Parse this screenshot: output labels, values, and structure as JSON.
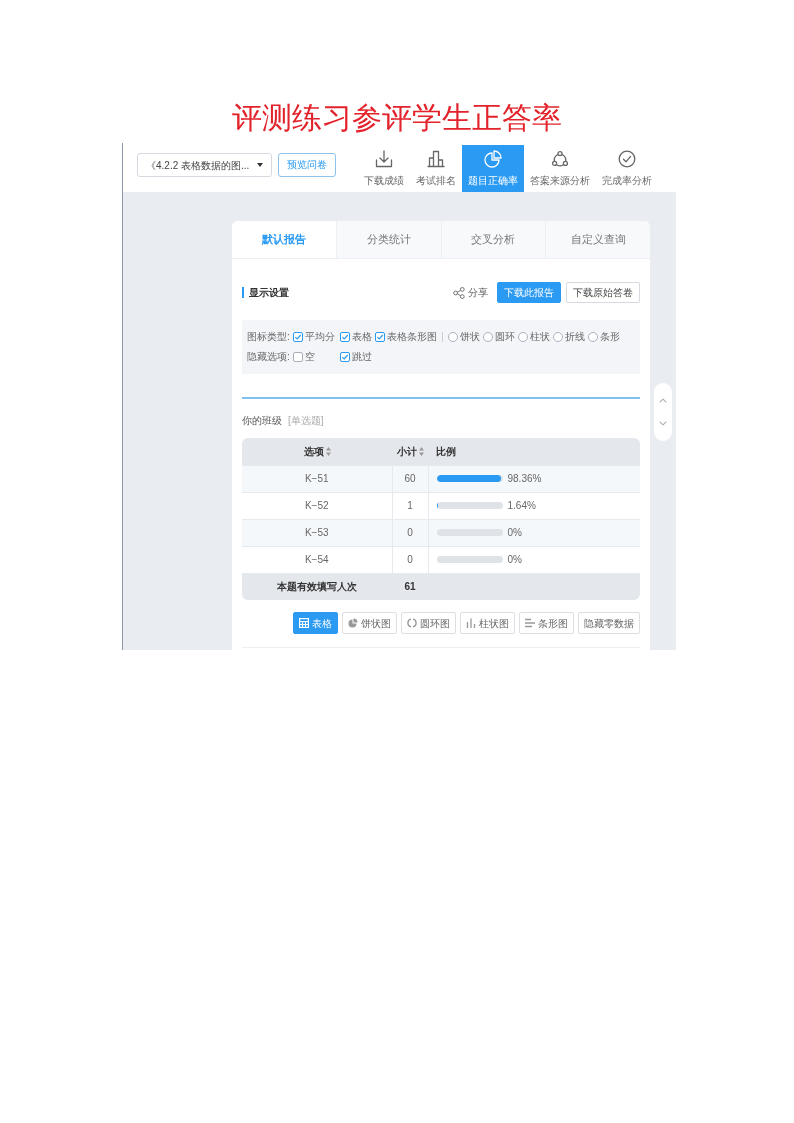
{
  "title": "评测练习参评学生正答率",
  "top_bar": {
    "survey_select": {
      "value": "《4.2.2 表格数据的图..."
    },
    "preview_button": "预览问卷",
    "tools": [
      {
        "label": "下载成绩",
        "kind": "download",
        "selected": false
      },
      {
        "label": "考试排名",
        "kind": "ranking",
        "selected": false
      },
      {
        "label": "题目正确率",
        "kind": "accuracy",
        "selected": true
      },
      {
        "label": "答案来源分析",
        "kind": "source",
        "selected": false
      },
      {
        "label": "完成率分析",
        "kind": "completion",
        "selected": false
      }
    ]
  },
  "report_tabs": [
    {
      "label": "默认报告",
      "selected": true
    },
    {
      "label": "分类统计",
      "selected": false
    },
    {
      "label": "交叉分析",
      "selected": false
    },
    {
      "label": "自定义查询",
      "selected": false
    }
  ],
  "display_settings": {
    "heading": "显示设置",
    "share_link": "分享",
    "download_report_button": "下载此报告",
    "download_answers_button": "下载原始答卷",
    "chart_type": {
      "label": "图标类型:",
      "checkboxes": [
        {
          "label": "平均分",
          "checked": true
        },
        {
          "label": "表格",
          "checked": true
        },
        {
          "label": "表格条形图",
          "checked": true
        }
      ],
      "radios": [
        {
          "label": "饼状",
          "selected": false
        },
        {
          "label": "圆环",
          "selected": false
        },
        {
          "label": "柱状",
          "selected": false
        },
        {
          "label": "折线",
          "selected": false
        },
        {
          "label": "条形",
          "selected": false
        }
      ]
    },
    "hidden_options": {
      "label": "隐藏选项:",
      "checkboxes": [
        {
          "label": "空",
          "checked": false
        },
        {
          "label": "跳过",
          "checked": true
        }
      ]
    }
  },
  "question": {
    "title": "你的班级",
    "type": "[单选题]",
    "table": {
      "columns": [
        {
          "label": "选项",
          "sortable": true
        },
        {
          "label": "小计",
          "sortable": true
        },
        {
          "label": "比例",
          "sortable": false
        }
      ],
      "rows": [
        {
          "option": "K−51",
          "count": "60",
          "level": 0.9836,
          "percent": "98.36%"
        },
        {
          "option": "K−52",
          "count": "1",
          "level": 0.0164,
          "percent": "1.64%"
        },
        {
          "option": "K−53",
          "count": "0",
          "level": 0,
          "percent": "0%"
        },
        {
          "option": "K−54",
          "count": "0",
          "level": 0,
          "percent": "0%"
        }
      ],
      "footer": {
        "label": "本题有效填写人次",
        "total": "61"
      }
    },
    "view_buttons": [
      {
        "label": "表格",
        "kind": "table",
        "selected": true
      },
      {
        "label": "饼状图",
        "kind": "pie",
        "selected": false
      },
      {
        "label": "圆环图",
        "kind": "ring",
        "selected": false
      },
      {
        "label": "柱状图",
        "kind": "column",
        "selected": false
      },
      {
        "label": "条形图",
        "kind": "bar",
        "selected": false
      }
    ],
    "hide_zero_button": "隐藏零数据"
  }
}
